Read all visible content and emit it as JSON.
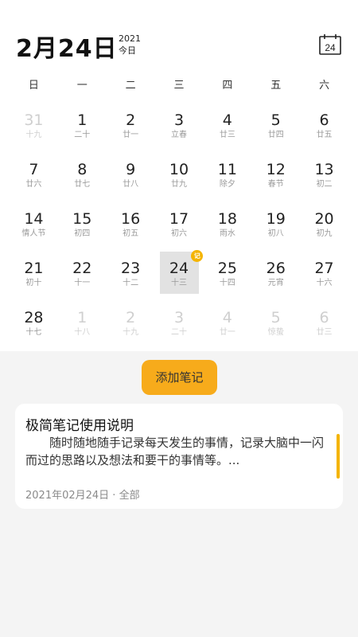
{
  "header": {
    "date_title": "2月24日",
    "year": "2021",
    "today_label": "今日",
    "today_icon_day": "24",
    "today_icon": "calendar-today-icon"
  },
  "weekdays": [
    "日",
    "一",
    "二",
    "三",
    "四",
    "五",
    "六"
  ],
  "days": [
    {
      "num": "31",
      "lunar": "十九",
      "other": true
    },
    {
      "num": "1",
      "lunar": "二十"
    },
    {
      "num": "2",
      "lunar": "廿一"
    },
    {
      "num": "3",
      "lunar": "立春"
    },
    {
      "num": "4",
      "lunar": "廿三"
    },
    {
      "num": "5",
      "lunar": "廿四"
    },
    {
      "num": "6",
      "lunar": "廿五"
    },
    {
      "num": "7",
      "lunar": "廿六"
    },
    {
      "num": "8",
      "lunar": "廿七"
    },
    {
      "num": "9",
      "lunar": "廿八"
    },
    {
      "num": "10",
      "lunar": "廿九"
    },
    {
      "num": "11",
      "lunar": "除夕"
    },
    {
      "num": "12",
      "lunar": "春节"
    },
    {
      "num": "13",
      "lunar": "初二"
    },
    {
      "num": "14",
      "lunar": "情人节"
    },
    {
      "num": "15",
      "lunar": "初四"
    },
    {
      "num": "16",
      "lunar": "初五"
    },
    {
      "num": "17",
      "lunar": "初六"
    },
    {
      "num": "18",
      "lunar": "雨水"
    },
    {
      "num": "19",
      "lunar": "初八"
    },
    {
      "num": "20",
      "lunar": "初九"
    },
    {
      "num": "21",
      "lunar": "初十"
    },
    {
      "num": "22",
      "lunar": "十一"
    },
    {
      "num": "23",
      "lunar": "十二"
    },
    {
      "num": "24",
      "lunar": "十三",
      "selected": true,
      "badge": "记"
    },
    {
      "num": "25",
      "lunar": "十四"
    },
    {
      "num": "26",
      "lunar": "元宵"
    },
    {
      "num": "27",
      "lunar": "十六"
    },
    {
      "num": "28",
      "lunar": "十七"
    },
    {
      "num": "1",
      "lunar": "十八",
      "other": true
    },
    {
      "num": "2",
      "lunar": "十九",
      "other": true
    },
    {
      "num": "3",
      "lunar": "二十",
      "other": true
    },
    {
      "num": "4",
      "lunar": "廿一",
      "other": true
    },
    {
      "num": "5",
      "lunar": "惊蛰",
      "other": true
    },
    {
      "num": "6",
      "lunar": "廿三",
      "other": true
    }
  ],
  "add_note_label": "添加笔记",
  "note": {
    "title": "极简笔记使用说明",
    "body": "随时随地随手记录每天发生的事情，记录大脑中一闪而过的思路以及想法和要干的事情等。...",
    "meta": "2021年02月24日 · 全部"
  },
  "colors": {
    "accent": "#f7ab1b",
    "badge": "#f4b400",
    "selected_bg": "#e2e2e2"
  }
}
